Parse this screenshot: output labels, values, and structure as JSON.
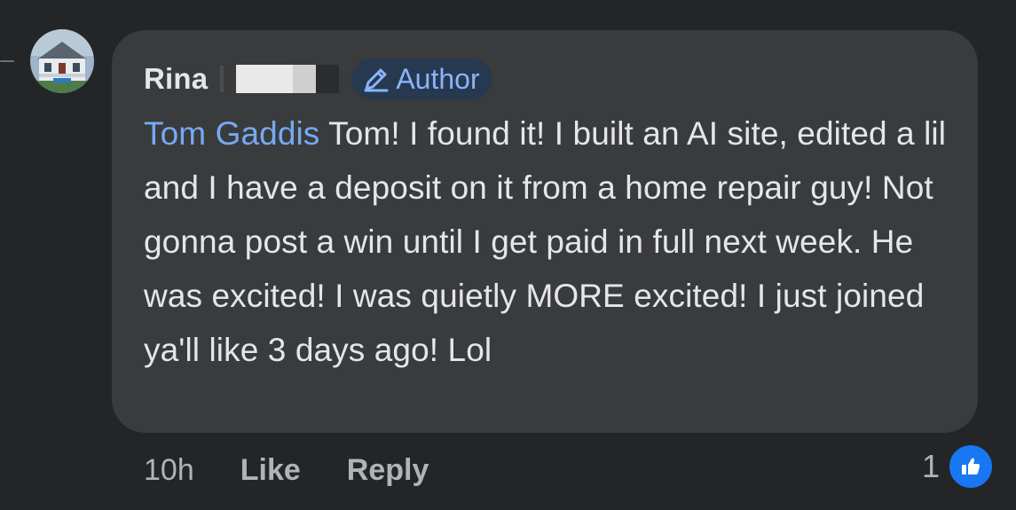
{
  "comment": {
    "author_name": "Rina",
    "author_badge": "Author",
    "mention": "Tom Gaddis",
    "text": " Tom! I found it! I built an AI site, edited a lil and I have a deposit on it from a home repair guy! Not gonna post a win until I get paid in full next week. He was excited! I was quietly MORE excited! I just joined ya'll like 3 days ago! Lol"
  },
  "actions": {
    "time": "10h",
    "like_label": "Like",
    "reply_label": "Reply"
  },
  "reactions": {
    "count": "1",
    "type": "like-reaction-icon",
    "color": "#1877f2"
  },
  "colors": {
    "background": "#242526",
    "bubble": "#3a3b3c",
    "mention": "#75a9f3",
    "badge_bg": "#263951",
    "badge_text": "#8ab4f8"
  }
}
